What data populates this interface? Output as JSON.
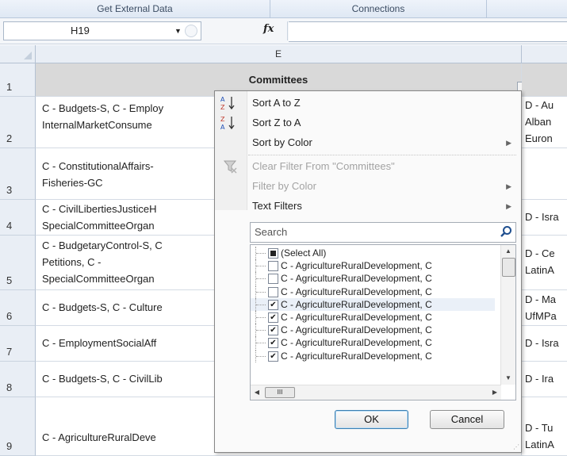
{
  "ribbon": {
    "groups": [
      "Get External Data",
      "Connections"
    ]
  },
  "formula_bar": {
    "name_box": "H19",
    "fx": "fx",
    "formula": ""
  },
  "grid": {
    "column_headers": [
      "E"
    ],
    "rows": [
      {
        "num": "1",
        "e": "Committees",
        "f": ""
      },
      {
        "num": "2",
        "e": "C - Budgets-S, C - Employ\nInternalMarketConsume",
        "f": "D - Au\nAlban\nEuron"
      },
      {
        "num": "3",
        "e": "C - ConstitutionalAffairs-\nFisheries-GC",
        "f": ""
      },
      {
        "num": "4",
        "e": "C - CivilLibertiesJusticeH\nSpecialCommitteeOrgan",
        "f": "D - Isra"
      },
      {
        "num": "5",
        "e": "C - BudgetaryControl-S, C\nPetitions, C -\nSpecialCommitteeOrgan",
        "f": "D - Ce\nLatinA"
      },
      {
        "num": "6",
        "e": "C - Budgets-S, C - Culture",
        "f": "D - Ma\nUfMPa"
      },
      {
        "num": "7",
        "e": "C - EmploymentSocialAff",
        "f": "D - Isra"
      },
      {
        "num": "8",
        "e": "C - Budgets-S, C - CivilLib",
        "f": "D - Ira"
      },
      {
        "num": "9",
        "e": "C - AgricultureRuralDeve",
        "f": "D - Tu\nLatinA"
      }
    ]
  },
  "filter_menu": {
    "sort_az": "Sort A to Z",
    "sort_za": "Sort Z to A",
    "sort_color": "Sort by Color",
    "clear_filter": "Clear Filter From \"Committees\"",
    "filter_color": "Filter by Color",
    "text_filters": "Text Filters",
    "search_placeholder": "Search",
    "items": [
      {
        "label": "(Select All)",
        "state": "partial"
      },
      {
        "label": "C - AgricultureRuralDevelopment, C",
        "state": "unchecked"
      },
      {
        "label": "C - AgricultureRuralDevelopment, C",
        "state": "unchecked"
      },
      {
        "label": "C - AgricultureRuralDevelopment, C",
        "state": "unchecked"
      },
      {
        "label": "C - AgricultureRuralDevelopment, C",
        "state": "checked"
      },
      {
        "label": "C - AgricultureRuralDevelopment, C",
        "state": "checked"
      },
      {
        "label": "C - AgricultureRuralDevelopment, C",
        "state": "checked"
      },
      {
        "label": "C - AgricultureRuralDevelopment, C",
        "state": "checked"
      },
      {
        "label": "C - AgricultureRuralDevelopment, C",
        "state": "checked"
      }
    ],
    "ok_label": "OK",
    "cancel_label": "Cancel",
    "scroll_thumb_glyph": "III"
  }
}
